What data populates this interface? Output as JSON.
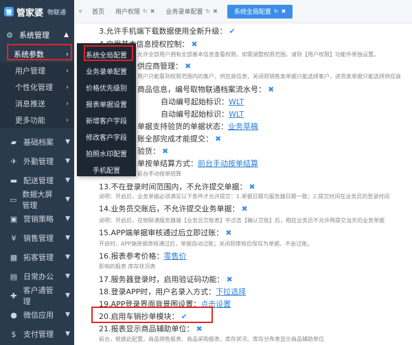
{
  "brand": {
    "name": "管家婆",
    "sub": "物联通",
    "logo_letter": "管"
  },
  "sidebar": {
    "top": {
      "label": "系统管理"
    },
    "sub_active": {
      "label": "系统参数"
    },
    "children": [
      "用户管理",
      "个性化管理",
      "消息推送",
      "更多功能"
    ],
    "groups": [
      "基础档案",
      "外勤管理",
      "配送管理",
      "数据大屏管理",
      "营销策略",
      "销售管理",
      "拓客管理",
      "日常办公",
      "客户通管理",
      "微信应用",
      "支付管理"
    ]
  },
  "flyout": [
    "系统全局配置",
    "业务录单配置",
    "价格优先级别",
    "报表单据设置",
    "新增客户字段",
    "修改客户字段",
    "拍照水印配置",
    "手机配置"
  ],
  "tabs": {
    "nav": "«",
    "items": [
      {
        "label": "首页"
      },
      {
        "label": "用户权限"
      },
      {
        "label": "业务录单配置"
      },
      {
        "label": "系统全局配置",
        "active": true
      }
    ]
  },
  "content": {
    "r3": "3.允许手机端下载数据使用全新升级：",
    "r4": "4.启用基本信息授权控制：",
    "r4_note": "允许全部用户拥有全部基本信息查看权限，如需调整权限范围，请到【用户权限】功能中单独设置。",
    "r5": "供应商管理：",
    "r5_note": "用户只能看到权限范围内的客户、供应商信息，关闭则销售类单据只能选择客户，进货类单据只能选择供应商",
    "r6": "商品信息，编号取物联通档案流水号：",
    "r6a": "自动编号起始标识：",
    "r6a_val": "WLT",
    "r6b": "自动编号起始标识：",
    "r6b_val": "WLT",
    "r7": "单据支持验货的单据状态：",
    "r7_link": "业务草稿",
    "r8": "账全部完成才能提交：",
    "r9": "验货：",
    "r10": "单按单结算方式：",
    "r10_link": "前台手动按单结算",
    "r10_note": "前台手动按单结算",
    "r13": "13.不在登录时间范围内，不允许提交单据：",
    "r13_note": "说明：开启后，业务单据必须满足以下条件才允许提交：1.单据日期与服务器日期一致；2.提交时间在业务员的登录时间",
    "r14": "14.业务员交账后，不允许提交业务单据：",
    "r14_note": "说明：开启后，在物联通服务器端【业务员交账表】中点击【确认交账】后，相应业务员不允许再提交当天的业务单据",
    "r15": "15.APP端单据审核通过后立即过账：",
    "r15_note": "开启时，APP端单据审核通过后，单据自动过账；关闭则审核后保存为单据，不会过账。",
    "r16": "16.报表参考价格：",
    "r16_link": "零售价",
    "r16_note": "影响的报表 库存状况表",
    "r17": "17.服务器登录时，启用验证码功能：",
    "r18": "18.登录APP时，用户名录入方式：",
    "r18_link": "下拉选择",
    "r19": "19.APP登录界面背景图设置：",
    "r19_link": "点击设置",
    "r20": "20.启用车销抄单模块：",
    "r21": "21.报表显示商品辅助单位：",
    "r21_note": "前台，根据此配置，商品销售报表、商品采购报表、库存状况、库存分布表显示商品辅助单位"
  },
  "icons": {
    "check": "✔",
    "cross": "✖"
  }
}
